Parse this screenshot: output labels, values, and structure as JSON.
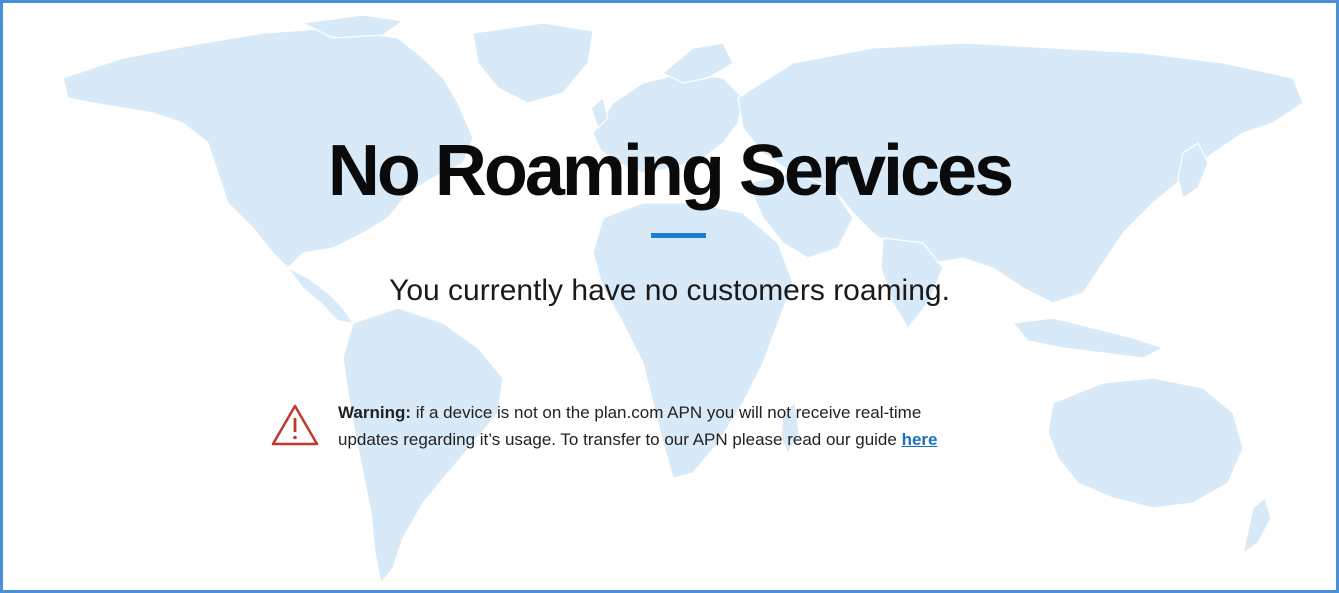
{
  "page": {
    "title": "No Roaming Services",
    "subtitle": "You currently have no customers roaming.",
    "accent_color": "#1a7fd4",
    "frame_color": "#4a90d9",
    "map_color": "#d6e8f7"
  },
  "warning": {
    "icon": "warning-triangle-icon",
    "icon_color": "#c0392b",
    "label": "Warning:",
    "line1": "if a device is not on the plan.com APN you will not receive real-time",
    "line2": "updates regarding it’s usage.  To transfer to our APN please read our guide",
    "link_text": "here"
  }
}
